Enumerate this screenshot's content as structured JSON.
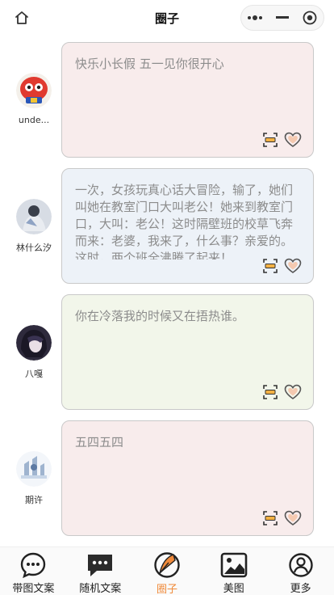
{
  "header": {
    "title": "圈子",
    "home_icon": "home-icon",
    "capsule_icons": [
      "more-dots-icon",
      "minimize-icon",
      "close-target-icon"
    ]
  },
  "posts": [
    {
      "author": "unde...",
      "text": "快乐小长假 五一见你很开心",
      "bubble_color": "#f8ecec"
    },
    {
      "author": "林什么汐",
      "text": "一次，女孩玩真心话大冒险，输了，她们叫她在教室门口大叫老公！她来到教室门口，大叫：老公！这时隔壁班的校草飞奔而来：老婆，我来了，什么事？亲爱的。这时，两个班全沸腾了起来！",
      "bubble_color": "#edf2f8"
    },
    {
      "author": "八嘎",
      "text": "你在冷落我的时候又在捂热谁。",
      "bubble_color": "#f2f6ea"
    },
    {
      "author": "期许",
      "text": "五四五四",
      "bubble_color": "#f8ecec"
    }
  ],
  "tabs": [
    {
      "label": "带图文案",
      "icon": "chat-bubble-icon",
      "active": false
    },
    {
      "label": "随机文案",
      "icon": "message-dots-icon",
      "active": false
    },
    {
      "label": "圈子",
      "icon": "circle-feather-icon",
      "active": true
    },
    {
      "label": "美图",
      "icon": "picture-icon",
      "active": false
    },
    {
      "label": "更多",
      "icon": "user-icon",
      "active": false
    }
  ],
  "colors": {
    "accent": "#f08a3a",
    "heart_fill": "#f4c9b0",
    "heart_stroke": "#555555",
    "copy_fill": "#f3b144"
  }
}
